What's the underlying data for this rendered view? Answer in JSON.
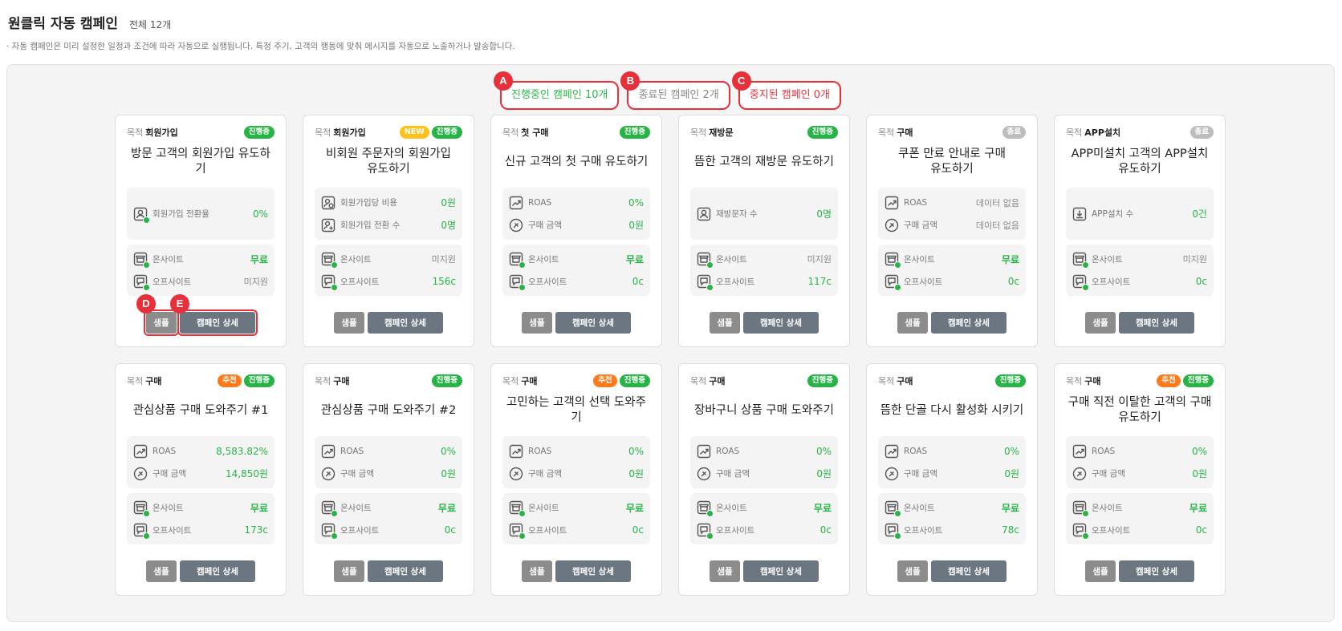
{
  "page": {
    "title": "원클릭 자동 캠페인",
    "total": "전체 12개",
    "description": "· 자동 캠페인은 미리 설정한 일정과 조건에 따라 자동으로 실행됩니다. 특정 주기, 고객의 행동에 맞춰 메시지를 자동으로 노출하거나 발송합니다."
  },
  "filters": [
    {
      "marker": "A",
      "label": "진행중인 캠페인 10개"
    },
    {
      "marker": "B",
      "label": "종료된 캠페인 2개"
    },
    {
      "marker": "C",
      "label": "중지된 캠페인 0개"
    }
  ],
  "labels": {
    "goal": "목적",
    "onsite": "온사이트",
    "offsite": "오프사이트",
    "sample": "샘플",
    "detail": "캠페인 상세",
    "marker_d": "D",
    "marker_e": "E"
  },
  "badge_text": {
    "running": "진행중",
    "ended": "종료",
    "new": "NEW",
    "recommend": "추천"
  },
  "colors": {
    "accent_green": "#27b446",
    "highlight_red": "#e8303a",
    "new_yellow": "#ffc21a",
    "recommend_orange": "#ff7a1a"
  },
  "cards": [
    {
      "goal": "회원가입",
      "badges": [
        "running"
      ],
      "title_lines": [
        "방문 고객의 회원가입 유도하기"
      ],
      "metrics": [
        {
          "icon": "user-percent-icon",
          "label": "회원가입 전환율",
          "value": "0%"
        }
      ],
      "onsite": "무료",
      "offsite": "미지원"
    },
    {
      "goal": "회원가입",
      "badges": [
        "new",
        "running"
      ],
      "title_lines": [
        "비회원 주문자의 회원가입",
        "유도하기"
      ],
      "metrics": [
        {
          "icon": "user-coin-icon",
          "label": "회원가입당 비용",
          "value": "0원"
        },
        {
          "icon": "user-add-icon",
          "label": "회원가입 전환 수",
          "value": "0명"
        }
      ],
      "onsite": "미지원",
      "offsite": "156c"
    },
    {
      "goal": "첫 구매",
      "badges": [
        "running"
      ],
      "title_lines": [
        "신규 고객의 첫 구매 유도하기"
      ],
      "metrics": [
        {
          "icon": "trend-up-icon",
          "label": "ROAS",
          "value": "0%"
        },
        {
          "icon": "tag-icon",
          "label": "구매 금액",
          "value": "0원"
        }
      ],
      "onsite": "무료",
      "offsite": "0c"
    },
    {
      "goal": "재방문",
      "badges": [
        "running"
      ],
      "title_lines": [
        "뜸한 고객의 재방문 유도하기"
      ],
      "metrics": [
        {
          "icon": "user-icon",
          "label": "재방문자 수",
          "value": "0명"
        }
      ],
      "onsite": "미지원",
      "offsite": "117c"
    },
    {
      "goal": "구매",
      "badges": [
        "ended"
      ],
      "title_lines": [
        "쿠폰 만료 안내로 구매",
        "유도하기"
      ],
      "metrics": [
        {
          "icon": "trend-up-icon",
          "label": "ROAS",
          "value": "데이터 없음"
        },
        {
          "icon": "tag-icon",
          "label": "구매 금액",
          "value": "데이터 없음"
        }
      ],
      "onsite": "무료",
      "offsite": "0c"
    },
    {
      "goal": "APP설치",
      "badges": [
        "ended"
      ],
      "title_lines": [
        "APP미설치 고객의 APP설치",
        "유도하기"
      ],
      "metrics": [
        {
          "icon": "download-icon",
          "label": "APP설치 수",
          "value": "0건"
        }
      ],
      "onsite": "미지원",
      "offsite": "0c"
    },
    {
      "goal": "구매",
      "badges": [
        "recommend",
        "running"
      ],
      "title_lines": [
        "관심상품 구매 도와주기 #1"
      ],
      "metrics": [
        {
          "icon": "trend-up-icon",
          "label": "ROAS",
          "value": "8,583.82%"
        },
        {
          "icon": "tag-icon",
          "label": "구매 금액",
          "value": "14,850원"
        }
      ],
      "onsite": "무료",
      "offsite": "173c"
    },
    {
      "goal": "구매",
      "badges": [
        "running"
      ],
      "title_lines": [
        "관심상품 구매 도와주기 #2"
      ],
      "metrics": [
        {
          "icon": "trend-up-icon",
          "label": "ROAS",
          "value": "0%"
        },
        {
          "icon": "tag-icon",
          "label": "구매 금액",
          "value": "0원"
        }
      ],
      "onsite": "무료",
      "offsite": "0c"
    },
    {
      "goal": "구매",
      "badges": [
        "recommend",
        "running"
      ],
      "title_lines": [
        "고민하는 고객의 선택 도와주기"
      ],
      "metrics": [
        {
          "icon": "trend-up-icon",
          "label": "ROAS",
          "value": "0%"
        },
        {
          "icon": "tag-icon",
          "label": "구매 금액",
          "value": "0원"
        }
      ],
      "onsite": "무료",
      "offsite": "0c"
    },
    {
      "goal": "구매",
      "badges": [
        "running"
      ],
      "title_lines": [
        "장바구니 상품 구매 도와주기"
      ],
      "metrics": [
        {
          "icon": "trend-up-icon",
          "label": "ROAS",
          "value": "0%"
        },
        {
          "icon": "tag-icon",
          "label": "구매 금액",
          "value": "0원"
        }
      ],
      "onsite": "무료",
      "offsite": "0c"
    },
    {
      "goal": "구매",
      "badges": [
        "running"
      ],
      "title_lines": [
        "뜸한 단골 다시 활성화 시키기"
      ],
      "metrics": [
        {
          "icon": "trend-up-icon",
          "label": "ROAS",
          "value": "0%"
        },
        {
          "icon": "tag-icon",
          "label": "구매 금액",
          "value": "0원"
        }
      ],
      "onsite": "무료",
      "offsite": "78c"
    },
    {
      "goal": "구매",
      "badges": [
        "recommend",
        "running"
      ],
      "title_lines": [
        "구매 직전 이탈한 고객의 구매",
        "유도하기"
      ],
      "metrics": [
        {
          "icon": "trend-up-icon",
          "label": "ROAS",
          "value": "0%"
        },
        {
          "icon": "tag-icon",
          "label": "구매 금액",
          "value": "0원"
        }
      ],
      "onsite": "무료",
      "offsite": "0c"
    }
  ]
}
